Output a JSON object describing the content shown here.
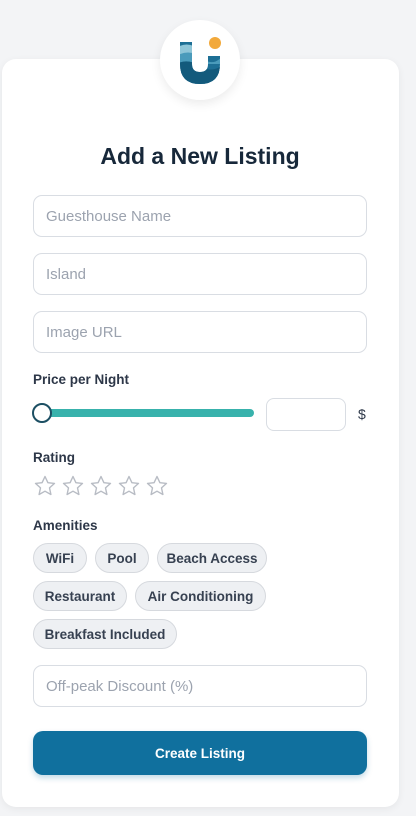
{
  "form": {
    "title": "Add a New Listing",
    "guesthouse_name_placeholder": "Guesthouse Name",
    "island_placeholder": "Island",
    "image_url_placeholder": "Image URL",
    "price_label": "Price per Night",
    "price_slider_value_fraction": 0,
    "price_value": "",
    "currency_symbol": "$",
    "rating_label": "Rating",
    "rating_value": 0,
    "rating_max": 5,
    "amenities_label": "Amenities",
    "amenities": [
      "WiFi",
      "Pool",
      "Beach Access",
      "Restaurant",
      "Air Conditioning",
      "Breakfast Included"
    ],
    "discount_placeholder": "Off-peak Discount (%)",
    "submit_label": "Create Listing"
  },
  "colors": {
    "accent": "#10709e",
    "slider": "#38b2ac",
    "logo_dot": "#f2a93b"
  },
  "icons": {
    "logo": "brand-u-logo-icon",
    "rating_star": "star-outline-icon"
  }
}
